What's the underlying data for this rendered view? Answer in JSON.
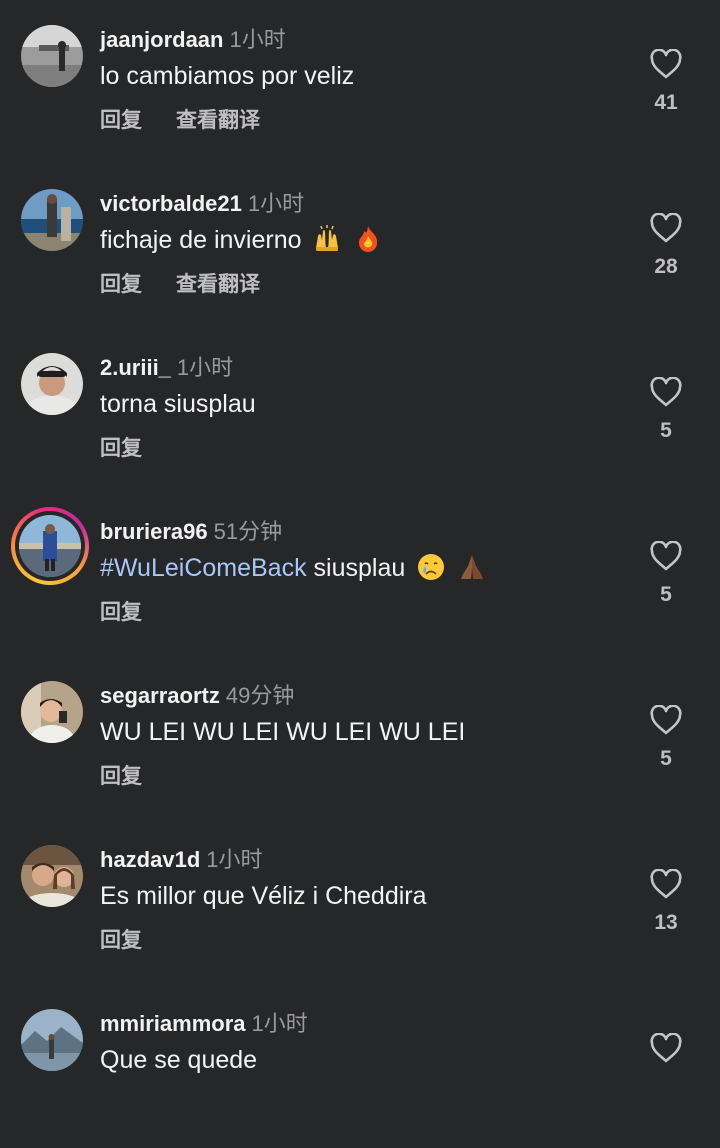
{
  "comments": [
    {
      "username": "jaanjordaan",
      "time": "1小时",
      "text": "lo cambiamos por veliz",
      "reply": "回复",
      "translate": "查看翻译",
      "likes": "41"
    },
    {
      "username": "victorbalde21",
      "time": "1小时",
      "text": "fichaje de invierno",
      "emoji": [
        "raising-hands-emoji",
        "fire-emoji"
      ],
      "reply": "回复",
      "translate": "查看翻译",
      "likes": "28"
    },
    {
      "username": "2.uriii_",
      "time": "1小时",
      "text": "torna siusplau",
      "reply": "回复",
      "likes": "5"
    },
    {
      "username": "bruriera96",
      "time": "51分钟",
      "hashtag": "#WuLeiComeBack",
      "text": " siusplau",
      "emoji": [
        "crying-face-emoji",
        "folded-hands-emoji"
      ],
      "reply": "回复",
      "likes": "5"
    },
    {
      "username": "segarraortz",
      "time": "49分钟",
      "text": "WU LEI WU LEI WU LEI WU LEI",
      "reply": "回复",
      "likes": "5"
    },
    {
      "username": "hazdav1d",
      "time": "1小时",
      "text": "Es millor que Véliz i Cheddira",
      "reply": "回复",
      "likes": "13"
    },
    {
      "username": "mmiriammora",
      "time": "1小时",
      "text": "Que se quede"
    }
  ],
  "colors": {
    "background": "#262729",
    "hashtag": "#a8c8f8",
    "story_ring": "#ee2a7b"
  }
}
